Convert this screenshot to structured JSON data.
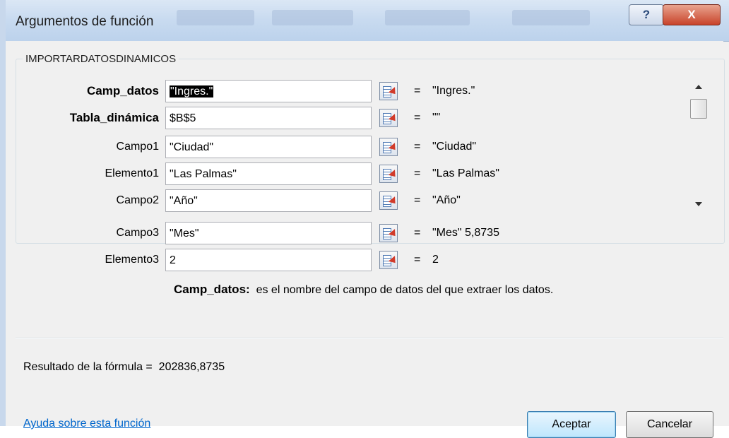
{
  "window": {
    "title": "Argumentos de función",
    "help_glyph": "?",
    "close_glyph": "X"
  },
  "function_name": "IMPORTARDATOSDINAMICOS",
  "arguments": [
    {
      "label": "Camp_datos",
      "bold": true,
      "input": "\"Ingres.\"",
      "selected": true,
      "value": "\"Ingres.\""
    },
    {
      "label": "Tabla_dinámica",
      "bold": true,
      "input": "$B$5",
      "selected": false,
      "value": "\"\""
    },
    {
      "label": "Campo1",
      "bold": false,
      "input": "\"Ciudad\"",
      "selected": false,
      "value": "\"Ciudad\""
    },
    {
      "label": "Elemento1",
      "bold": false,
      "input": "\"Las Palmas\"",
      "selected": false,
      "value": "\"Las Palmas\""
    },
    {
      "label": "Campo2",
      "bold": false,
      "input": "\"Año\"",
      "selected": false,
      "value": "\"Año\""
    },
    {
      "label": "Campo3",
      "bold": false,
      "input": "\"Mes\"",
      "selected": false,
      "value": "\"Mes\" 5,8735"
    },
    {
      "label": "Elemento3",
      "bold": false,
      "input": "2",
      "selected": false,
      "value": "2"
    }
  ],
  "equals_sign": "=",
  "description": {
    "arg_name": "Camp_datos:",
    "text": "es el nombre del campo de datos del que extraer los datos."
  },
  "result": {
    "label": "Resultado de la fórmula =",
    "value": "202836,8735"
  },
  "help_link": "Ayuda sobre esta función",
  "buttons": {
    "ok": "Aceptar",
    "cancel": "Cancelar"
  }
}
